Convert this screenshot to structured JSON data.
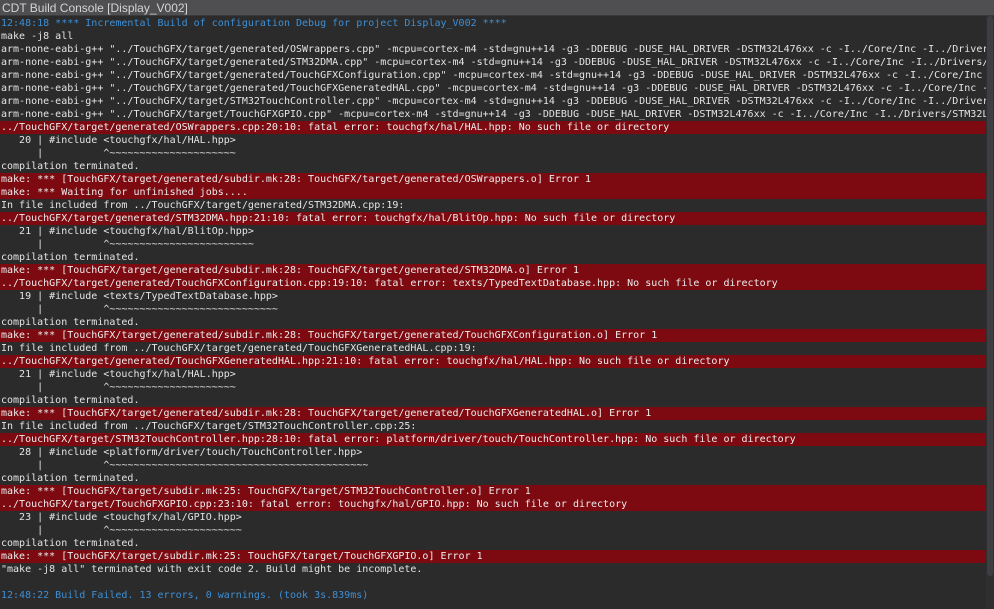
{
  "window": {
    "title": "CDT Build Console [Display_V002]"
  },
  "colors": {
    "background": "#2b2b2b",
    "text": "#e4e4e4",
    "info_text": "#3d8fd6",
    "error_background": "#7c0a10"
  },
  "console": {
    "lines": [
      {
        "type": "info",
        "text": "12:48:18 **** Incremental Build of configuration Debug for project Display_V002 ****"
      },
      {
        "type": "normal",
        "text": "make -j8 all"
      },
      {
        "type": "normal",
        "text": "arm-none-eabi-g++ \"../TouchGFX/target/generated/OSWrappers.cpp\" -mcpu=cortex-m4 -std=gnu++14 -g3 -DDEBUG -DUSE_HAL_DRIVER -DSTM32L476xx -c -I../Core/Inc -I../Drivers/"
      },
      {
        "type": "normal",
        "text": "arm-none-eabi-g++ \"../TouchGFX/target/generated/STM32DMA.cpp\" -mcpu=cortex-m4 -std=gnu++14 -g3 -DDEBUG -DUSE_HAL_DRIVER -DSTM32L476xx -c -I../Core/Inc -I../Drivers/S"
      },
      {
        "type": "normal",
        "text": "arm-none-eabi-g++ \"../TouchGFX/target/generated/TouchGFXConfiguration.cpp\" -mcpu=cortex-m4 -std=gnu++14 -g3 -DDEBUG -DUSE_HAL_DRIVER -DSTM32L476xx -c -I../Core/Inc -"
      },
      {
        "type": "normal",
        "text": "arm-none-eabi-g++ \"../TouchGFX/target/generated/TouchGFXGeneratedHAL.cpp\" -mcpu=cortex-m4 -std=gnu++14 -g3 -DDEBUG -DUSE_HAL_DRIVER -DSTM32L476xx -c -I../Core/Inc -I"
      },
      {
        "type": "normal",
        "text": "arm-none-eabi-g++ \"../TouchGFX/target/STM32TouchController.cpp\" -mcpu=cortex-m4 -std=gnu++14 -g3 -DDEBUG -DUSE_HAL_DRIVER -DSTM32L476xx -c -I../Core/Inc -I../Drivers"
      },
      {
        "type": "normal",
        "text": "arm-none-eabi-g++ \"../TouchGFX/target/TouchGFXGPIO.cpp\" -mcpu=cortex-m4 -std=gnu++14 -g3 -DDEBUG -DUSE_HAL_DRIVER -DSTM32L476xx -c -I../Core/Inc -I../Drivers/STM32L4"
      },
      {
        "type": "error",
        "text": "../TouchGFX/target/generated/OSWrappers.cpp:20:10: fatal error: touchgfx/hal/HAL.hpp: No such file or directory"
      },
      {
        "type": "normal",
        "text": "   20 | #include <touchgfx/hal/HAL.hpp>"
      },
      {
        "type": "normal",
        "text": "      |          ^~~~~~~~~~~~~~~~~~~~~~"
      },
      {
        "type": "normal",
        "text": "compilation terminated."
      },
      {
        "type": "error",
        "text": "make: *** [TouchGFX/target/generated/subdir.mk:28: TouchGFX/target/generated/OSWrappers.o] Error 1"
      },
      {
        "type": "error",
        "text": "make: *** Waiting for unfinished jobs...."
      },
      {
        "type": "normal",
        "text": "In file included from ../TouchGFX/target/generated/STM32DMA.cpp:19:"
      },
      {
        "type": "error",
        "text": "../TouchGFX/target/generated/STM32DMA.hpp:21:10: fatal error: touchgfx/hal/BlitOp.hpp: No such file or directory"
      },
      {
        "type": "normal",
        "text": "   21 | #include <touchgfx/hal/BlitOp.hpp>"
      },
      {
        "type": "normal",
        "text": "      |          ^~~~~~~~~~~~~~~~~~~~~~~~~"
      },
      {
        "type": "normal",
        "text": "compilation terminated."
      },
      {
        "type": "error",
        "text": "make: *** [TouchGFX/target/generated/subdir.mk:28: TouchGFX/target/generated/STM32DMA.o] Error 1"
      },
      {
        "type": "error",
        "text": "../TouchGFX/target/generated/TouchGFXConfiguration.cpp:19:10: fatal error: texts/TypedTextDatabase.hpp: No such file or directory"
      },
      {
        "type": "normal",
        "text": "   19 | #include <texts/TypedTextDatabase.hpp>"
      },
      {
        "type": "normal",
        "text": "      |          ^~~~~~~~~~~~~~~~~~~~~~~~~~~~~"
      },
      {
        "type": "normal",
        "text": "compilation terminated."
      },
      {
        "type": "error",
        "text": "make: *** [TouchGFX/target/generated/subdir.mk:28: TouchGFX/target/generated/TouchGFXConfiguration.o] Error 1"
      },
      {
        "type": "normal",
        "text": "In file included from ../TouchGFX/target/generated/TouchGFXGeneratedHAL.cpp:19:"
      },
      {
        "type": "error",
        "text": "../TouchGFX/target/generated/TouchGFXGeneratedHAL.hpp:21:10: fatal error: touchgfx/hal/HAL.hpp: No such file or directory"
      },
      {
        "type": "normal",
        "text": "   21 | #include <touchgfx/hal/HAL.hpp>"
      },
      {
        "type": "normal",
        "text": "      |          ^~~~~~~~~~~~~~~~~~~~~~"
      },
      {
        "type": "normal",
        "text": "compilation terminated."
      },
      {
        "type": "error",
        "text": "make: *** [TouchGFX/target/generated/subdir.mk:28: TouchGFX/target/generated/TouchGFXGeneratedHAL.o] Error 1"
      },
      {
        "type": "normal",
        "text": "In file included from ../TouchGFX/target/STM32TouchController.cpp:25:"
      },
      {
        "type": "error",
        "text": "../TouchGFX/target/STM32TouchController.hpp:28:10: fatal error: platform/driver/touch/TouchController.hpp: No such file or directory"
      },
      {
        "type": "normal",
        "text": "   28 | #include <platform/driver/touch/TouchController.hpp>"
      },
      {
        "type": "normal",
        "text": "      |          ^~~~~~~~~~~~~~~~~~~~~~~~~~~~~~~~~~~~~~~~~~~~"
      },
      {
        "type": "normal",
        "text": "compilation terminated."
      },
      {
        "type": "error",
        "text": "make: *** [TouchGFX/target/subdir.mk:25: TouchGFX/target/STM32TouchController.o] Error 1"
      },
      {
        "type": "error",
        "text": "../TouchGFX/target/TouchGFXGPIO.cpp:23:10: fatal error: touchgfx/hal/GPIO.hpp: No such file or directory"
      },
      {
        "type": "normal",
        "text": "   23 | #include <touchgfx/hal/GPIO.hpp>"
      },
      {
        "type": "normal",
        "text": "      |          ^~~~~~~~~~~~~~~~~~~~~~~"
      },
      {
        "type": "normal",
        "text": "compilation terminated."
      },
      {
        "type": "error",
        "text": "make: *** [TouchGFX/target/subdir.mk:25: TouchGFX/target/TouchGFXGPIO.o] Error 1"
      },
      {
        "type": "normal",
        "text": "\"make -j8 all\" terminated with exit code 2. Build might be incomplete."
      },
      {
        "type": "blank",
        "text": ""
      },
      {
        "type": "info",
        "text": "12:48:22 Build Failed. 13 errors, 0 warnings. (took 3s.839ms)"
      }
    ]
  }
}
